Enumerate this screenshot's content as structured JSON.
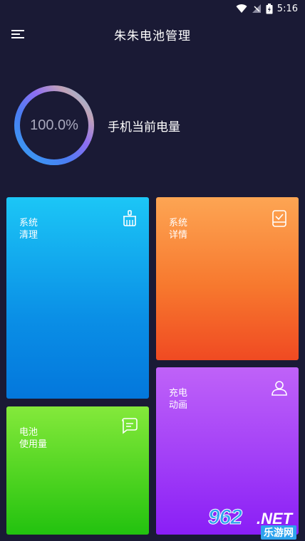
{
  "status_bar": {
    "time": "5:16"
  },
  "toolbar": {
    "title": "朱朱电池管理"
  },
  "battery": {
    "percent_text": "100.0%",
    "level": 1.0,
    "label": "手机当前电量"
  },
  "cards": {
    "clean": {
      "line1": "系统",
      "line2": "清理",
      "icon": "broom-icon"
    },
    "detail": {
      "line1": "系统",
      "line2": "详情",
      "icon": "tablet-check-icon"
    },
    "usage": {
      "line1": "电池",
      "line2": "使用量",
      "icon": "message-lines-icon"
    },
    "animation": {
      "line1": "充电",
      "line2": "动画",
      "icon": "user-icon"
    }
  },
  "colors": {
    "background": "#1a1a35",
    "clean": "#0a8fe6",
    "detail": "#f7782e",
    "usage": "#4fd421",
    "animation": "#a23ff7"
  },
  "watermark": {
    "number": "962",
    "net": ".NET",
    "sub": "乐游网"
  }
}
